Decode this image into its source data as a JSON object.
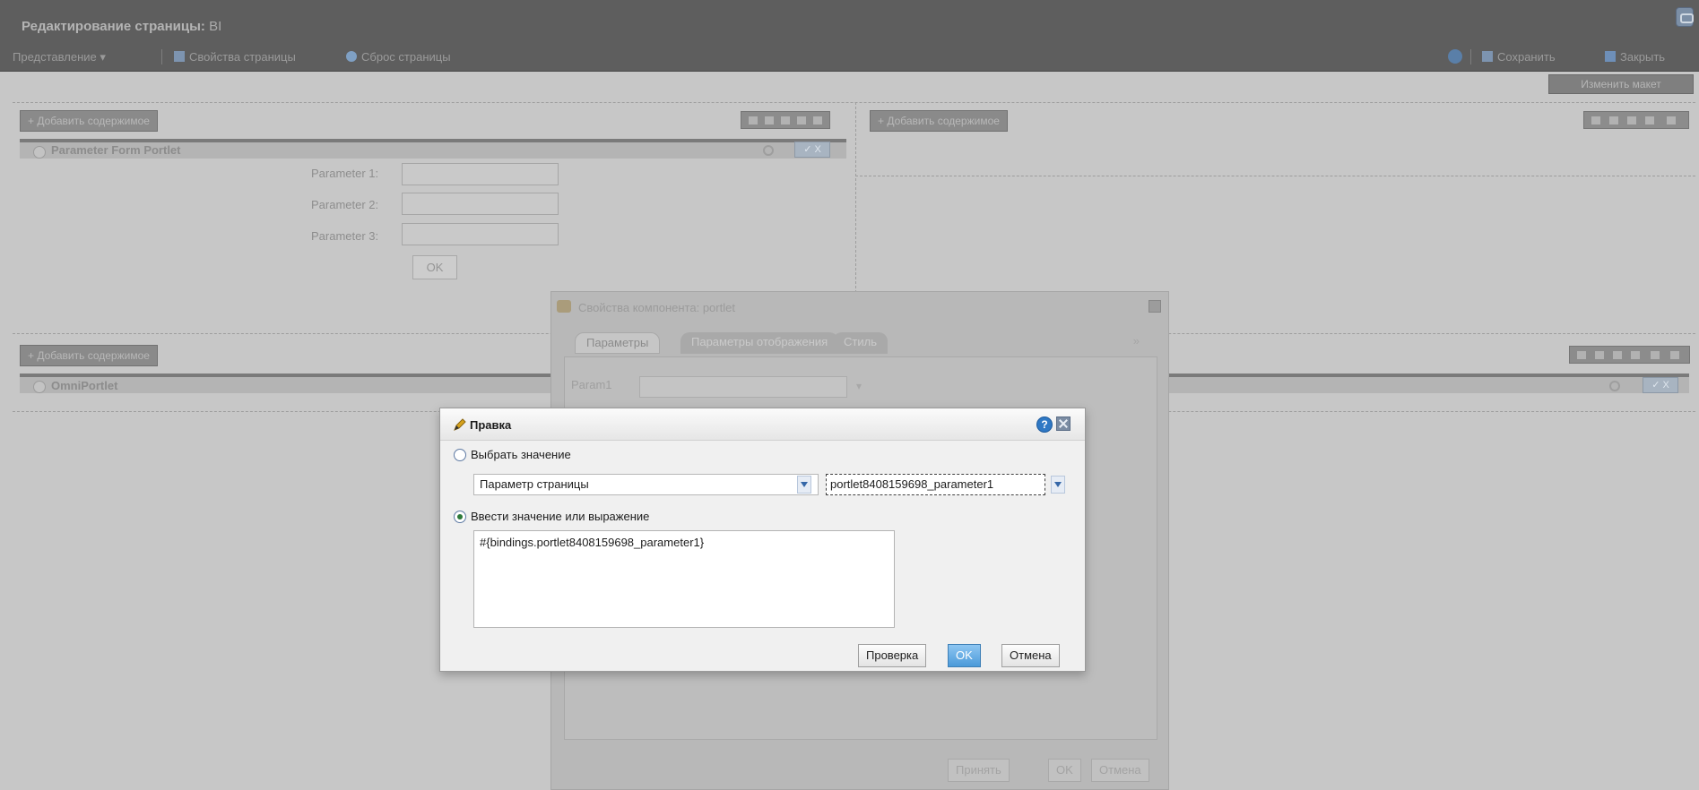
{
  "header": {
    "title_prefix": "Редактирование страницы:",
    "title_name": "BI"
  },
  "toolbar": {
    "view_menu": "Представление ▾",
    "page_properties": "Свойства страницы",
    "page_reset": "Сброс страницы",
    "save": "Сохранить",
    "close": "Закрыть"
  },
  "change_layout": "Изменить макет",
  "layout": {
    "add_content": "+ Добавить содержимое",
    "portlet1_title": "Parameter Form Portlet",
    "portlet2_title": "OmniPortlet",
    "params": [
      "Parameter 1:",
      "Parameter 2:",
      "Parameter 3:"
    ],
    "ok": "OK",
    "portlet_close": "✓ X"
  },
  "props_dialog": {
    "title": "Свойства компонента: portlet",
    "tabs": [
      "Параметры",
      "Параметры отображения",
      "Стиль"
    ],
    "param_label": "Param1",
    "chevron": "»",
    "buttons": [
      "Принять",
      "OK",
      "Отмена"
    ]
  },
  "edit_dialog": {
    "title": "Правка",
    "help": "?",
    "option_select": "Выбрать значение",
    "page_param_value": "Параметр страницы",
    "param_value": "portlet8408159698_parameter1",
    "option_expression": "Ввести значение или выражение",
    "expression": "#{bindings.portlet8408159698_parameter1}",
    "btn_check": "Проверка",
    "btn_ok": "OK",
    "btn_cancel": "Отмена"
  },
  "colors": {
    "header_bg": "#5e5e5e",
    "overlay_bg": "#c7c7c7",
    "ok_button": "#4b9ad9",
    "help_icon": "#2f78c4"
  }
}
